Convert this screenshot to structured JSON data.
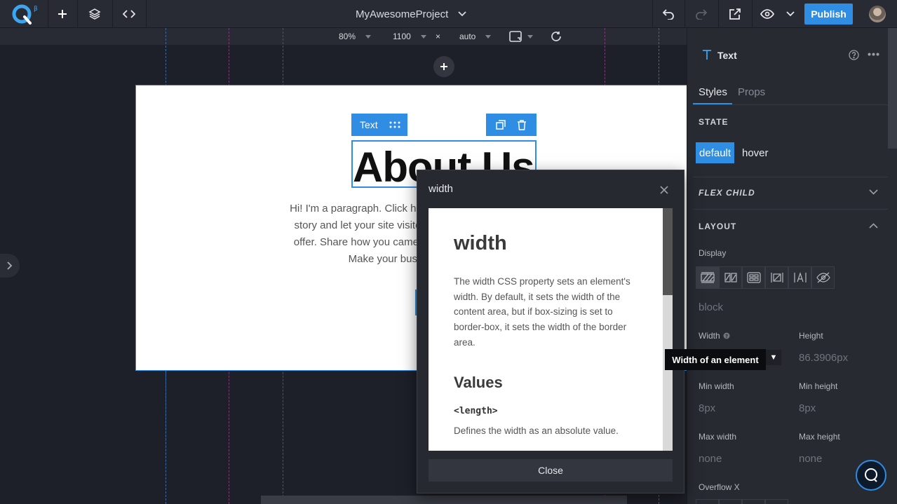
{
  "topbar": {
    "logo_superscript": "β",
    "project_name": "MyAwesomeProject",
    "publish_label": "Publish"
  },
  "toolbar2": {
    "zoom": "80%",
    "canvas_width": "1100",
    "times": "×",
    "canvas_height": "auto"
  },
  "canvas": {
    "element_tag": "Text",
    "heading": "About Us",
    "paragraph_lines": [
      "Hi! I'm a paragraph. Click here to add your own text a",
      "story and let your site visitors know more about you",
      "offer. Share how you came up with the idea for your",
      "Make your business stand o"
    ]
  },
  "modal": {
    "title": "width",
    "doc_title": "width",
    "doc_desc": "The width CSS property sets an element's width. By default, it sets the width of the content area, but if box-sizing is set to border-box, it sets the width of the border area.",
    "values_heading": "Values",
    "length_term": "<length>",
    "length_desc": "Defines the width as an absolute value.",
    "close_label": "Close"
  },
  "panel": {
    "element_name": "Text",
    "tabs": [
      "Styles",
      "Props"
    ],
    "state_heading": "STATE",
    "state_default": "default",
    "state_hover": "hover",
    "flex_child_heading": "FLEX CHILD",
    "layout_heading": "LAYOUT",
    "display_label": "Display",
    "display_value": "block",
    "width_label": "Width",
    "height_label": "Height",
    "height_value": "86.3906px",
    "min_width_label": "Min width",
    "min_width_value": "8px",
    "min_height_label": "Min height",
    "min_height_value": "8px",
    "max_width_label": "Max width",
    "max_width_value": "none",
    "max_height_label": "Max height",
    "max_height_value": "none",
    "overflow_x_label": "Overflow X",
    "tooltip": "Width of an element",
    "width_dropdown_glyph": "▼"
  },
  "colors": {
    "accent": "#2f8de4",
    "topbar": "#282b33",
    "canvas_bg": "#1d2028",
    "panel_bg": "#272a31"
  }
}
